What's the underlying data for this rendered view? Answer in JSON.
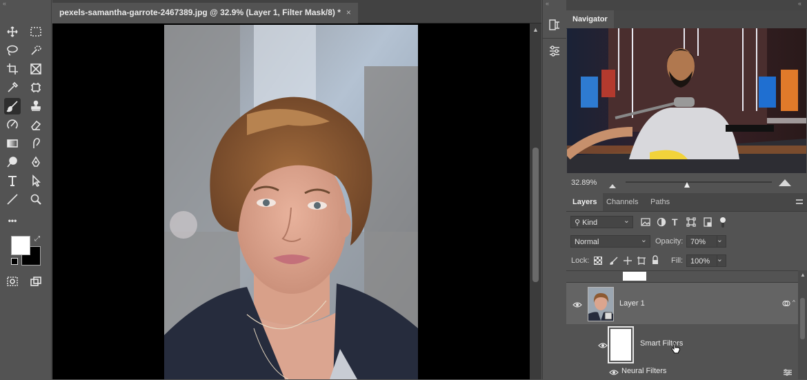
{
  "tabs_grip": "«",
  "document": {
    "tab_title": "pexels-samantha-garrote-2467389.jpg @ 32.9% (Layer 1, Filter Mask/8) *",
    "close_glyph": "×"
  },
  "toolbar": {
    "tools": [
      "move-tool",
      "marquee-tool",
      "lasso-tool",
      "quick-selection-tool",
      "crop-tool",
      "frame-tool",
      "eyedropper-tool",
      "patch-tool",
      "brush-tool",
      "clone-stamp-tool",
      "history-brush-tool",
      "eraser-tool",
      "gradient-tool",
      "smudge-tool",
      "dodge-tool",
      "pen-tool",
      "type-tool",
      "path-selection-tool",
      "line-tool",
      "zoom-tool",
      "more-tools"
    ],
    "more_label": "•••",
    "foreground_color": "#ffffff",
    "background_color": "#000000"
  },
  "navigator": {
    "title": "Navigator",
    "zoom": "32.89%"
  },
  "layers_panel": {
    "tabs": [
      "Layers",
      "Channels",
      "Paths"
    ],
    "filter_kind": "Kind",
    "blend_mode": "Normal",
    "opacity_label": "Opacity:",
    "opacity_value": "70%",
    "lock_label": "Lock:",
    "fill_label": "Fill:",
    "fill_value": "100%",
    "layers": [
      {
        "name": "Layer 1",
        "visible": true
      },
      {
        "name": "Smart Filters",
        "visible": true
      },
      {
        "name": "Neural Filters",
        "visible": true
      }
    ]
  },
  "colors": {
    "panel_bg": "#535353",
    "canvas_bg": "#000000",
    "selected_layer": "#646464"
  }
}
